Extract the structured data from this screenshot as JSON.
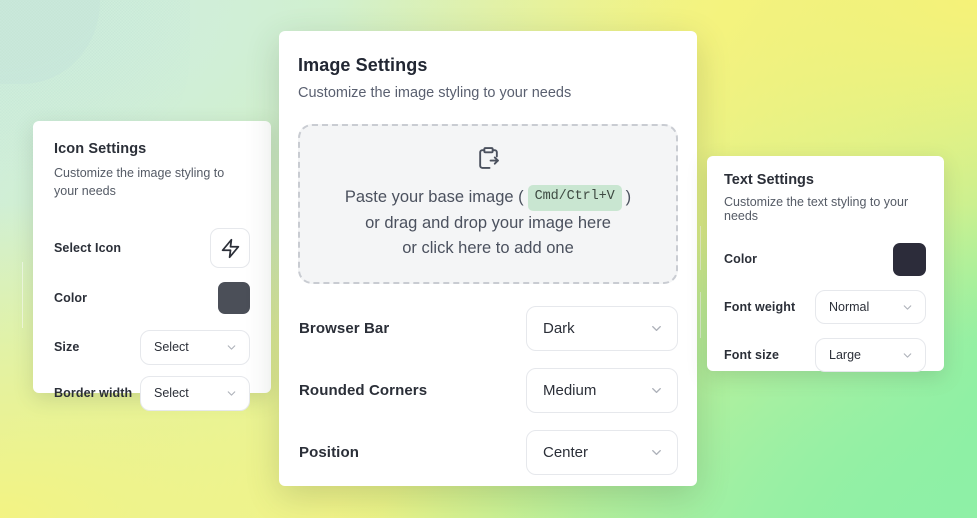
{
  "background": {
    "colors": [
      "#cfeedd",
      "#f6f278",
      "#b8ef9e",
      "#7fefa2",
      "#f3f383"
    ]
  },
  "icon_panel": {
    "title": "Icon Settings",
    "subtitle": "Customize the image styling to your needs",
    "rows": {
      "select_icon": {
        "label": "Select Icon",
        "icon": "zap-icon"
      },
      "color": {
        "label": "Color",
        "value": "#4b4f58"
      },
      "size": {
        "label": "Size",
        "value": "Select"
      },
      "border_width": {
        "label": "Border width",
        "value": "Select"
      }
    }
  },
  "image_panel": {
    "title": "Image Settings",
    "subtitle": "Customize the image styling to your needs",
    "dropzone": {
      "icon": "clipboard-paste-icon",
      "line1_before": "Paste your base image (",
      "shortcut": "Cmd/Ctrl+V",
      "line1_after": ")",
      "line2": "or drag and drop your image here",
      "line3": "or click here to add one"
    },
    "rows": [
      {
        "label": "Browser Bar",
        "value": "Dark"
      },
      {
        "label": "Rounded Corners",
        "value": "Medium"
      },
      {
        "label": "Position",
        "value": "Center"
      }
    ]
  },
  "text_panel": {
    "title": "Text Settings",
    "subtitle": "Customize the text styling to your needs",
    "rows": {
      "color": {
        "label": "Color",
        "value": "#2c2c3a"
      },
      "font_weight": {
        "label": "Font weight",
        "value": "Normal"
      },
      "font_size": {
        "label": "Font size",
        "value": "Large"
      }
    }
  }
}
